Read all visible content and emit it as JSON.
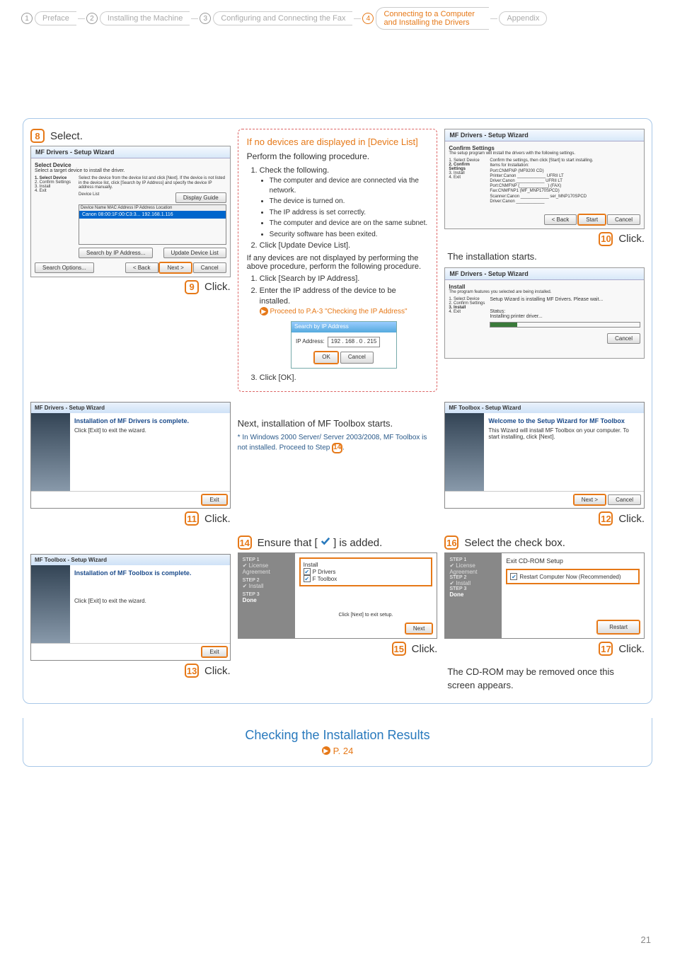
{
  "breadcrumb": [
    {
      "num": "1",
      "label": "Preface"
    },
    {
      "num": "2",
      "label": "Installing the Machine"
    },
    {
      "num": "3",
      "label": "Configuring and Connecting the Fax"
    },
    {
      "num": "4",
      "label": "Connecting to a Computer and Installing the Drivers"
    },
    {
      "num": "",
      "label": "Appendix"
    }
  ],
  "active_crumb_index": 3,
  "step8": {
    "num": "8",
    "label": "Select."
  },
  "step9": {
    "num": "9",
    "label": "Click."
  },
  "step10": {
    "num": "10",
    "label": "Click."
  },
  "step11": {
    "num": "11",
    "label": "Click."
  },
  "step12": {
    "num": "12",
    "label": "Click."
  },
  "step13": {
    "num": "13",
    "label": "Click."
  },
  "step14": {
    "num": "14",
    "label_pre": "Ensure that [",
    "label_post": "] is added."
  },
  "step15": {
    "num": "15",
    "label": "Click."
  },
  "step16": {
    "num": "16",
    "label": "Select the check box."
  },
  "step17": {
    "num": "17",
    "label": "Click."
  },
  "shot_select_device": {
    "title": "MF Drivers - Setup Wizard",
    "heading": "Select Device",
    "sub": "Select a target device to install the driver.",
    "left_items": [
      "1.  Select Device",
      "2.  Confirm Settings",
      "3.  Install",
      "4.  Exit"
    ],
    "instr": "Select the device from the device list and click [Next]. If the device is not listed in the device list, click [Search by IP Address] and specify the device IP address manually.",
    "list_label": "Device List",
    "display_guide": "Display Guide",
    "cols": "Device Name        MAC Address        IP Address        Location",
    "row": "Canon        08:00:1F:00:C3:3... 192.168.1.116",
    "btn_search_ip": "Search by IP Address...",
    "btn_update": "Update Device List",
    "btn_search_opts": "Search Options...",
    "btn_back": "< Back",
    "btn_next": "Next >",
    "btn_cancel": "Cancel"
  },
  "callout": {
    "title": "If no devices are displayed in [Device List]",
    "lead": "Perform the following procedure.",
    "ol1": "Check the following.",
    "ul": [
      "The computer and device are connected via the network.",
      "The device is turned on.",
      "The IP address is set correctly.",
      "The computer and device are on the same subnet.",
      "Security software has been exited."
    ],
    "ol2": "Click [Update Device List].",
    "mid": "If any devices are not displayed by performing the above procedure, perform the following procedure.",
    "ol3": "Click [Search by IP Address].",
    "ol4": "Enter the IP address of the device to be installed.",
    "proceed": "Proceed to P.A-3 \"Checking the IP Address\"",
    "ip_dialog": {
      "title": "Search by IP Address",
      "label": "IP Address:",
      "val": "192 . 168 . 0 . 215",
      "ok": "OK",
      "cancel": "Cancel"
    },
    "ol5": "Click [OK]."
  },
  "confirm_shot": {
    "title": "MF Drivers - Setup Wizard",
    "heading": "Confirm Settings",
    "sub": "The setup program will install the drivers with the following settings.",
    "left_items": [
      "1.  Select Device",
      "2.  Confirm Settings",
      "3.  Install",
      "4.  Exit"
    ],
    "body_lines": [
      "Confirm the settings, then click [Start] to start installing.",
      "Items for Installation:",
      "Port:CNMFNP (MF9200 CD)",
      "  Printer:Canon ____________ UFRII LT",
      "  Driver:Canon ____________ UFRII LT",
      "Port:CNMFNP (____________) (FAX)",
      "  Fax:CNMFNP1 (MF_MNP170SPCD)",
      "Scanner:Canon ____________ ser_MNP170SPCD",
      "  Driver:Canon ____________"
    ],
    "btn_back": "< Back",
    "btn_start": "Start",
    "btn_cancel": "Cancel"
  },
  "install_starts": "The installation starts.",
  "install_shot": {
    "title": "MF Drivers - Setup Wizard",
    "heading": "Install",
    "sub": "The program features you selected are being installed.",
    "left_items": [
      "1.  Select Device",
      "2.  Confirm Settings",
      "3.  Install",
      "4.  Exit"
    ],
    "msg": "Setup Wizard is installing MF Drivers. Please wait...",
    "status_lbl": "Status:",
    "status": "Installing printer driver...",
    "btn_cancel": "Cancel"
  },
  "complete_shot": {
    "title": "MF Drivers - Setup Wizard",
    "h": "Installation of MF Drivers is complete.",
    "msg": "Click [Exit] to exit the wizard.",
    "btn": "Exit"
  },
  "midnote": {
    "title": "Next, installation of MF Toolbox starts.",
    "body_pre": "*  In Windows 2000 Server/ Server 2003/2008, MF Toolbox is not installed. Proceed to Step ",
    "body_step": "14",
    "body_post": "."
  },
  "toolbox_welcome": {
    "title": "MF Toolbox - Setup Wizard",
    "h": "Welcome to the Setup Wizard for MF Toolbox",
    "msg": "This Wizard will install MF Toolbox on your computer. To start installing, click [Next].",
    "btn_next": "Next >",
    "btn_cancel": "Cancel"
  },
  "toolbox_complete": {
    "title": "MF Toolbox - Setup Wizard",
    "h": "Installation of MF Toolbox is complete.",
    "msg": "Click [Exit] to exit the wizard.",
    "btn": "Exit"
  },
  "ensure_shot": {
    "side": [
      "✔  License Agreement",
      "✔  Install"
    ],
    "side_step3": "STEP 3",
    "side_done": "Done",
    "items_label": "Install",
    "items": [
      "P Drivers",
      "F Toolbox"
    ],
    "hint": "Click [Next] to exit setup.",
    "btn_next": "Next"
  },
  "exit_shot": {
    "side": [
      "✔  License Agreement",
      "STEP 2",
      "✔  Install",
      "STEP 3",
      "Done"
    ],
    "h": "Exit CD-ROM Setup",
    "chk": "Restart Computer Now (Recommended)",
    "btn": "Restart"
  },
  "cdrom_note": "The CD-ROM may be removed once this screen appears.",
  "bottom": {
    "title": "Checking the Installation Results",
    "link": "P. 24"
  },
  "page_num": "21"
}
